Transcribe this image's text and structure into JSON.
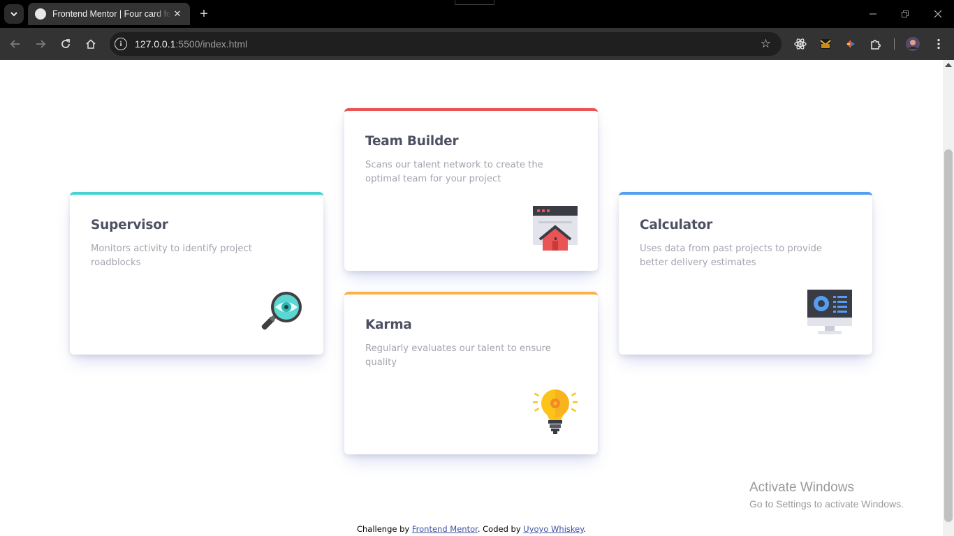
{
  "browser": {
    "tab_title": "Frontend Mentor | Four card feature section",
    "url_host": "127.0.0.1",
    "url_path": ":5500/index.html"
  },
  "cards": [
    {
      "title": "Supervisor",
      "description": "Monitors activity to identify project roadblocks",
      "accent": "#44d3d2",
      "icon": "magnifier-eye-icon"
    },
    {
      "title": "Team Builder",
      "description": "Scans our talent network to create the optimal team for your project",
      "accent": "#ea5454",
      "icon": "browser-house-icon"
    },
    {
      "title": "Karma",
      "description": "Regularly evaluates our talent to ensure quality",
      "accent": "#fcaf4a",
      "icon": "lightbulb-icon"
    },
    {
      "title": "Calculator",
      "description": "Uses data from past projects to provide better delivery estimates",
      "accent": "#549ef2",
      "icon": "monitor-dashboard-icon"
    }
  ],
  "attribution": {
    "prefix": "Challenge by",
    "challenge_link": "Frontend Mentor",
    "middle": ". Coded by",
    "coder_link": "Uyoyo Whiskey",
    "suffix": "."
  },
  "watermark": {
    "title": "Activate Windows",
    "subtitle": "Go to Settings to activate Windows."
  }
}
